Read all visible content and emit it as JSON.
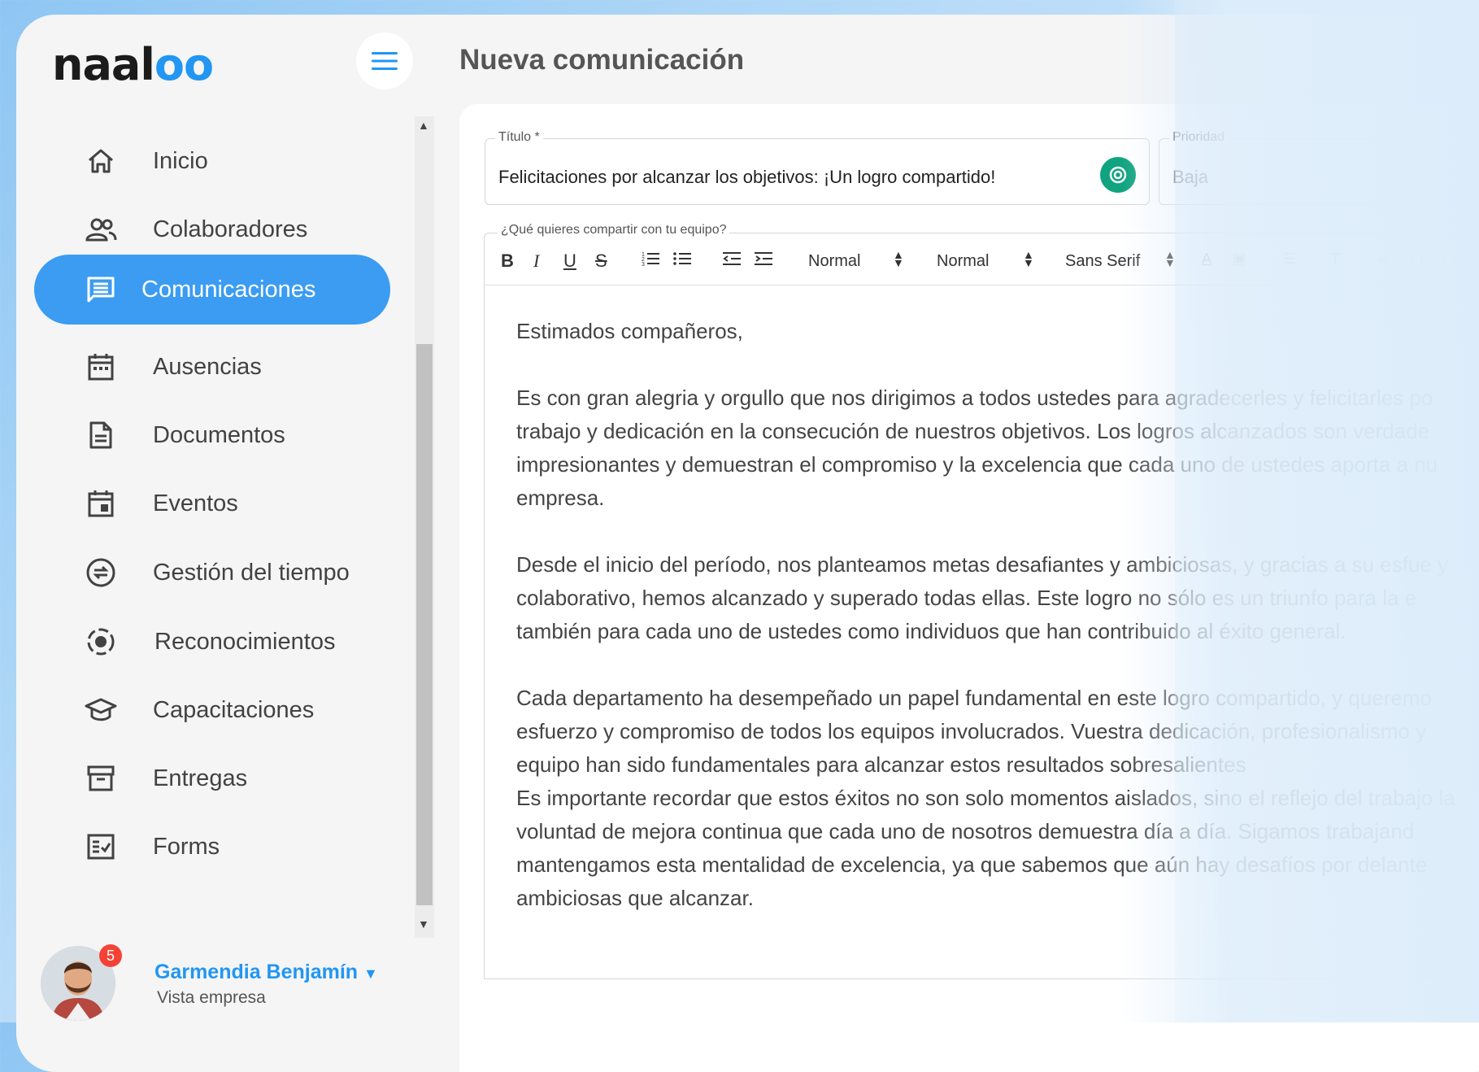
{
  "app": {
    "logo_text_a": "naal",
    "logo_text_b": "oo",
    "page_title": "Nueva comunicación"
  },
  "sidebar": {
    "items": [
      {
        "label": "Inicio",
        "icon": "home-icon"
      },
      {
        "label": "Colaboradores",
        "icon": "people-icon"
      },
      {
        "label": "Comunicaciones",
        "icon": "message-icon",
        "active": true
      },
      {
        "label": "Ausencias",
        "icon": "calendar-icon"
      },
      {
        "label": "Documentos",
        "icon": "document-icon"
      },
      {
        "label": "Eventos",
        "icon": "event-icon"
      },
      {
        "label": "Gestión del tiempo",
        "icon": "time-icon"
      },
      {
        "label": "Reconocimientos",
        "icon": "recognition-icon"
      },
      {
        "label": "Capacitaciones",
        "icon": "school-icon"
      },
      {
        "label": "Entregas",
        "icon": "archive-icon"
      },
      {
        "label": "Forms",
        "icon": "form-icon"
      }
    ]
  },
  "user": {
    "name": "Garmendia Benjamín",
    "role": "Vista empresa",
    "notifications": "5"
  },
  "form": {
    "title_label": "Título *",
    "title_value": "Felicitaciones por alcanzar los objetivos: ¡Un logro compartido!",
    "priority_label": "Prioridad",
    "priority_value": "Baja",
    "editor_label": "¿Qué quieres compartir con tu equipo?"
  },
  "toolbar": {
    "bold": "B",
    "italic": "I",
    "underline": "U",
    "strike": "S",
    "heading_select": "Normal",
    "size_select": "Normal",
    "font_select": "Sans Serif"
  },
  "editor": {
    "greeting": "Estimados compañeros,",
    "p1": "Es con gran alegria y orgullo que nos dirigimos a todos ustedes para agradecerles y felicitarles po trabajo y dedicación en la consecución de nuestros objetivos. Los logros alcanzados son verdade impresionantes y demuestran el compromiso y la excelencia que cada uno de ustedes aporta a nu empresa.",
    "p2": "Desde el inicio del período, nos planteamos metas desafiantes y ambiciosas, y gracias a su esfue y colaborativo, hemos alcanzado y superado todas ellas. Este logro no sólo es un triunfo para la e también para cada uno de ustedes como individuos que han contribuido al éxito general.",
    "p3": "Cada departamento ha desempeñado un papel fundamental en este logro compartido, y queremo esfuerzo y compromiso de todos los equipos involucrados. Vuestra dedicación, profesionalismo y equipo han sido fundamentales para alcanzar estos resultados sobresalientes",
    "p4": "Es importante recordar que estos éxitos no son solo momentos aislados, sino el reflejo del trabajo la voluntad de mejora continua que cada uno de nosotros demuestra día a día. Sigamos trabajand mantengamos esta mentalidad de excelencia, ya que sabemos que aún hay desafíos por delante ambiciosas que alcanzar."
  },
  "colors": {
    "accent": "#3b9cf2",
    "ai_button": "#10a37f",
    "badge": "#f44336"
  }
}
